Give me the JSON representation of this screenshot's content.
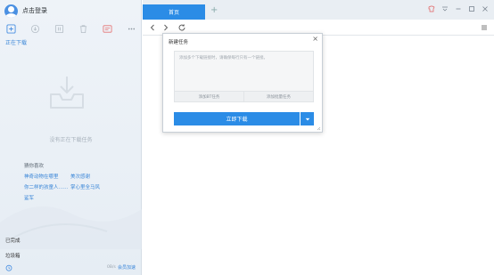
{
  "sidebar": {
    "login_label": "点击登录",
    "tab_downloading": "正在下载",
    "empty_text": "没有正在下载任务",
    "recommend_title": "猜你喜欢",
    "recommend_links": [
      "神奇动物在哪里",
      "美次感谢",
      "你二样的孩童人……",
      "掌心里全马风",
      "鲨军"
    ],
    "nav_completed": "已完成",
    "nav_trash": "垃圾箱",
    "speed": "0B/s",
    "vip_label": "会员加速"
  },
  "tabs": {
    "home_label": "首页",
    "new_tab": "+"
  },
  "dialog": {
    "title": "新建任务",
    "close": "×",
    "placeholder": "添加多个下载链接时，请确保每行只有一个链接。",
    "add_bt": "添加BT任务",
    "add_batch": "添加批量任务",
    "download_now": "立即下载"
  },
  "colors": {
    "accent": "#2b8ce6",
    "link": "#3a86d8"
  }
}
